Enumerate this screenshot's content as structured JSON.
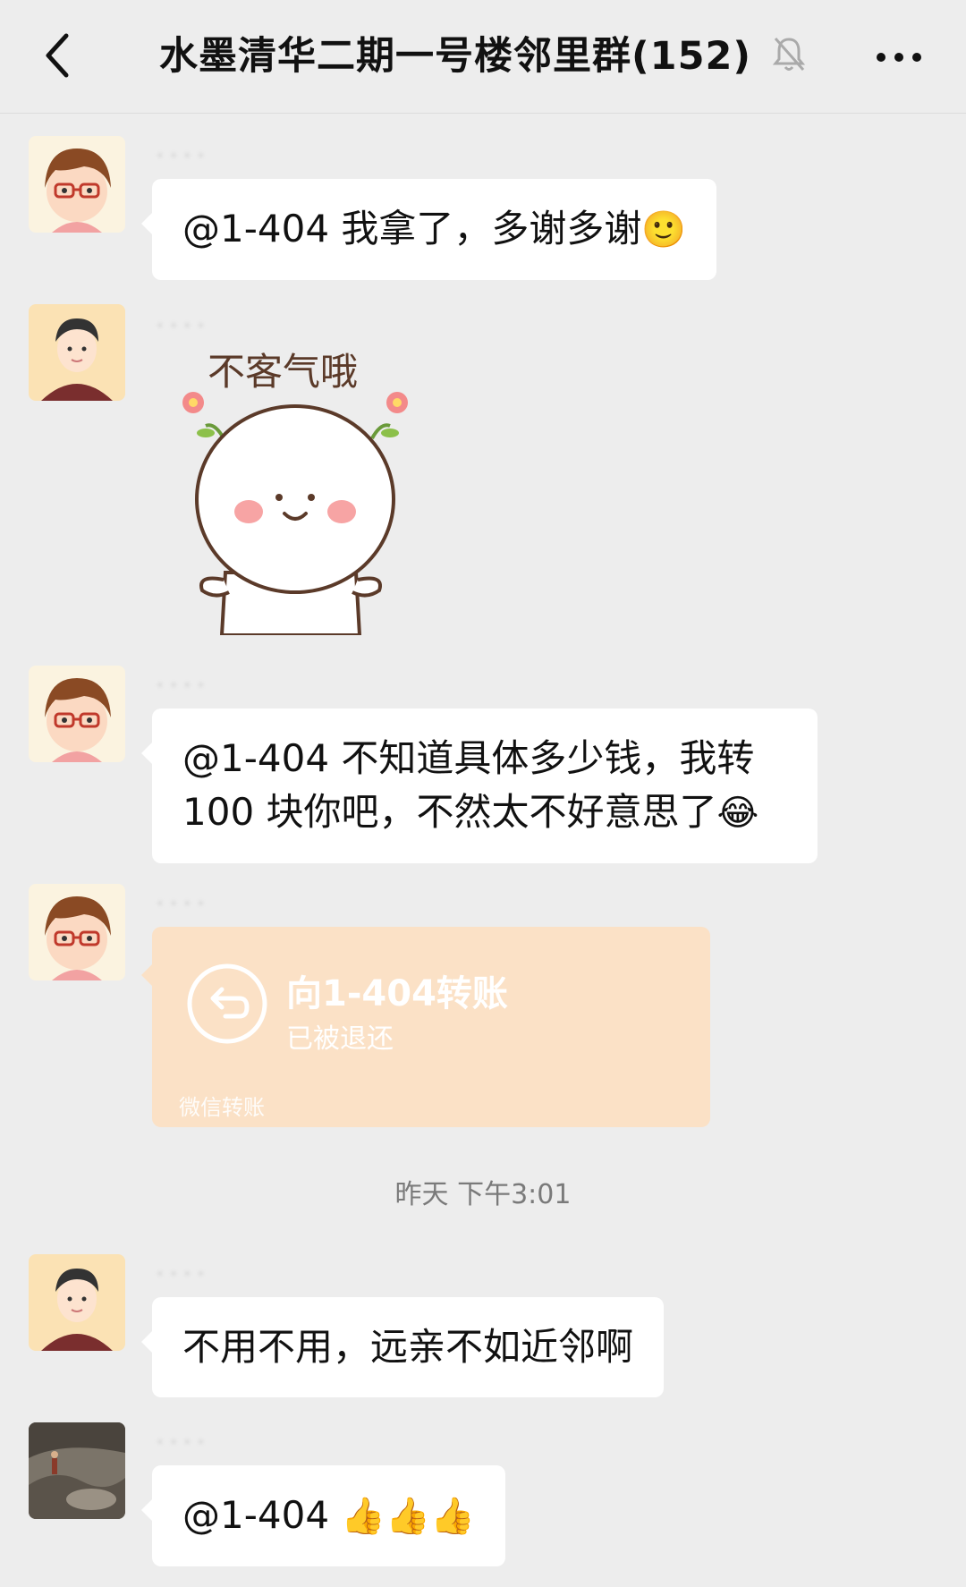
{
  "header": {
    "title": "水墨清华二期一号楼邻里群(152)"
  },
  "messages": [
    {
      "text": "@1-404  我拿了，多谢多谢",
      "emoji": "🙂"
    },
    {
      "sticker_text": "不客气哦"
    },
    {
      "text_line1": "@1-404  不知道具体多少钱，我转",
      "text_line2": "100 块你吧，不然太不好意思了",
      "emoji": "😂"
    },
    {
      "transfer": {
        "title": "向1-404转账",
        "status": "已被退还",
        "footer": "微信转账"
      }
    },
    {
      "text": "不用不用，远亲不如近邻啊"
    },
    {
      "text": "@1-404 ",
      "emoji": "👍👍👍"
    }
  ],
  "timestamp": "昨天 下午3:01",
  "colors": {
    "background": "#ededed",
    "bubble": "#ffffff",
    "transfer_card": "#fbe1c6"
  },
  "icons": [
    "back-chevron-icon",
    "mute-bell-icon",
    "more-dots-icon",
    "return-arrow-icon"
  ]
}
